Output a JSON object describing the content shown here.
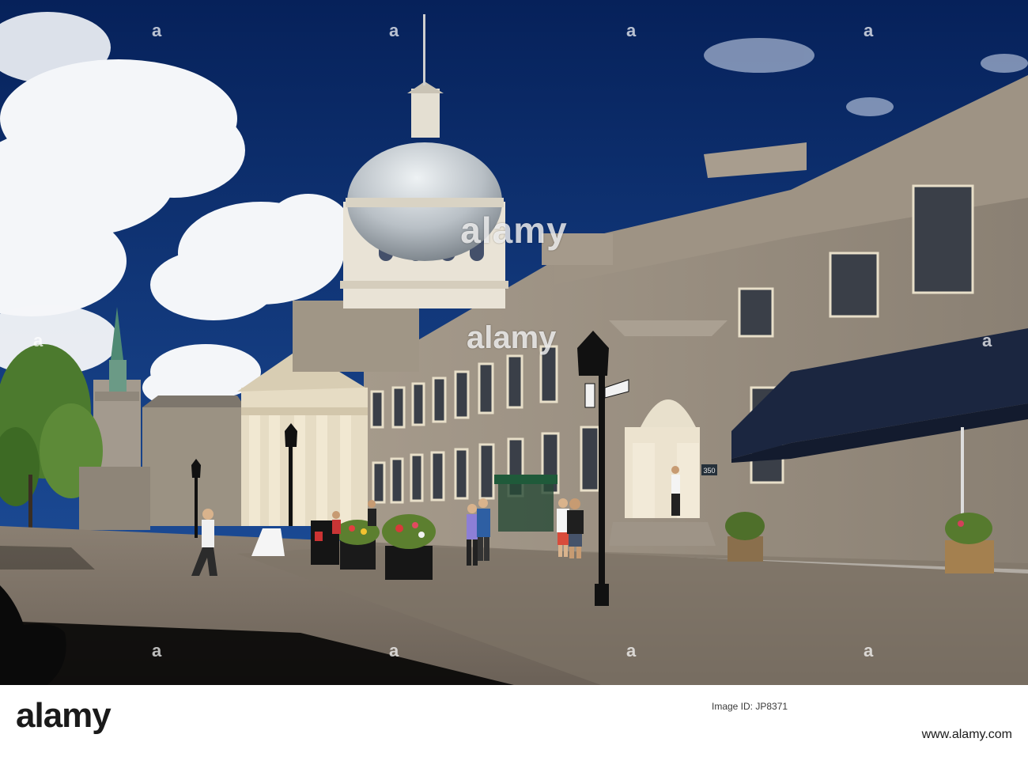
{
  "watermark": {
    "brand": "alamy",
    "letter": "a"
  },
  "sign": {
    "number": "350"
  },
  "footer": {
    "logo": "alamy",
    "image_id_label": "Image ID: JP8371",
    "url": "www.alamy.com"
  },
  "colors": {
    "sky": "#0e2f6e",
    "stone": "#8c8274",
    "dome": "#b8bfc4",
    "awning": "#1b2640",
    "pavement": "#7a6f64"
  }
}
